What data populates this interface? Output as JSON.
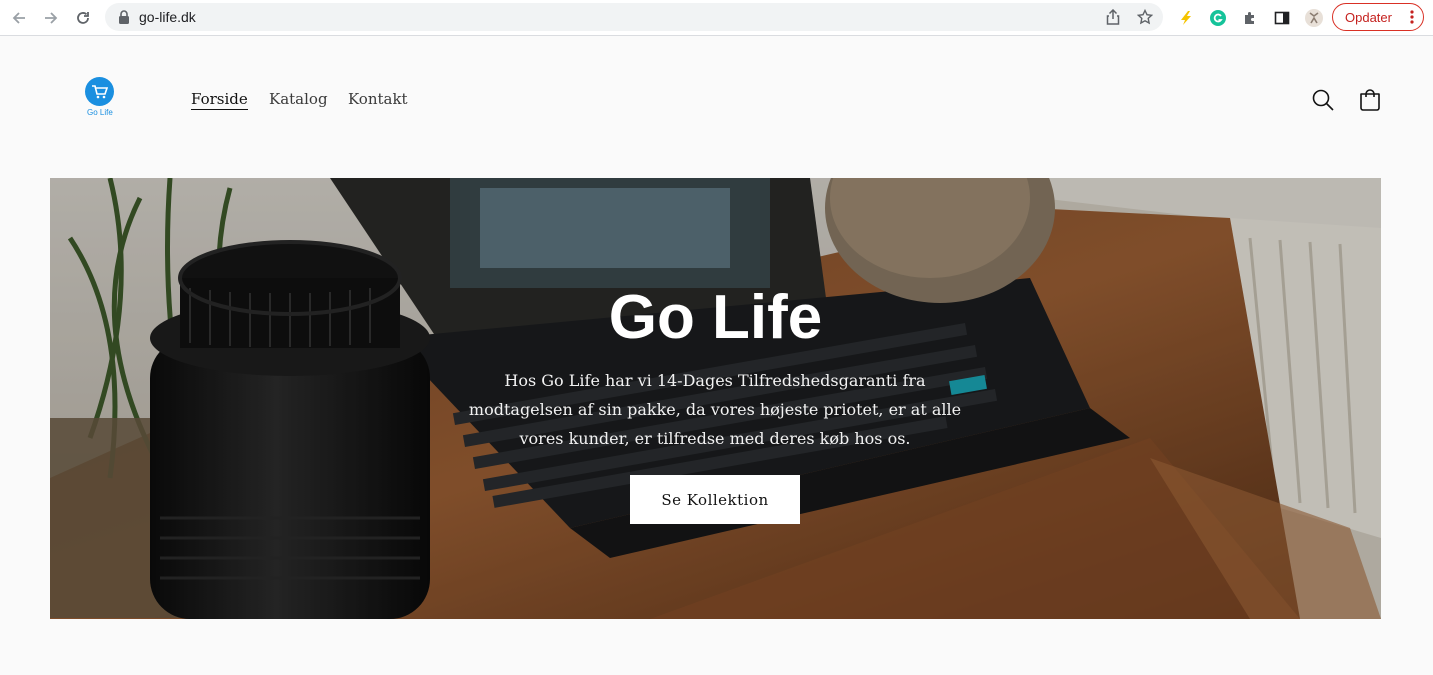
{
  "browser": {
    "url": "go-life.dk",
    "update_label": "Opdater"
  },
  "site": {
    "logo_text": "Go Life",
    "brand_color": "#1a8fe0",
    "menu": [
      {
        "label": "Forside",
        "active": true
      },
      {
        "label": "Katalog",
        "active": false
      },
      {
        "label": "Kontakt",
        "active": false
      }
    ]
  },
  "hero": {
    "title": "Go Life",
    "text": "Hos Go Life har vi 14-Dages Tilfredshedsgaranti fra modtagelsen af sin pakke, da vores højeste prio­tet, er at alle vores kunder, er tilfredse med deres køb hos os.",
    "button_label": "Se Kollektion"
  }
}
